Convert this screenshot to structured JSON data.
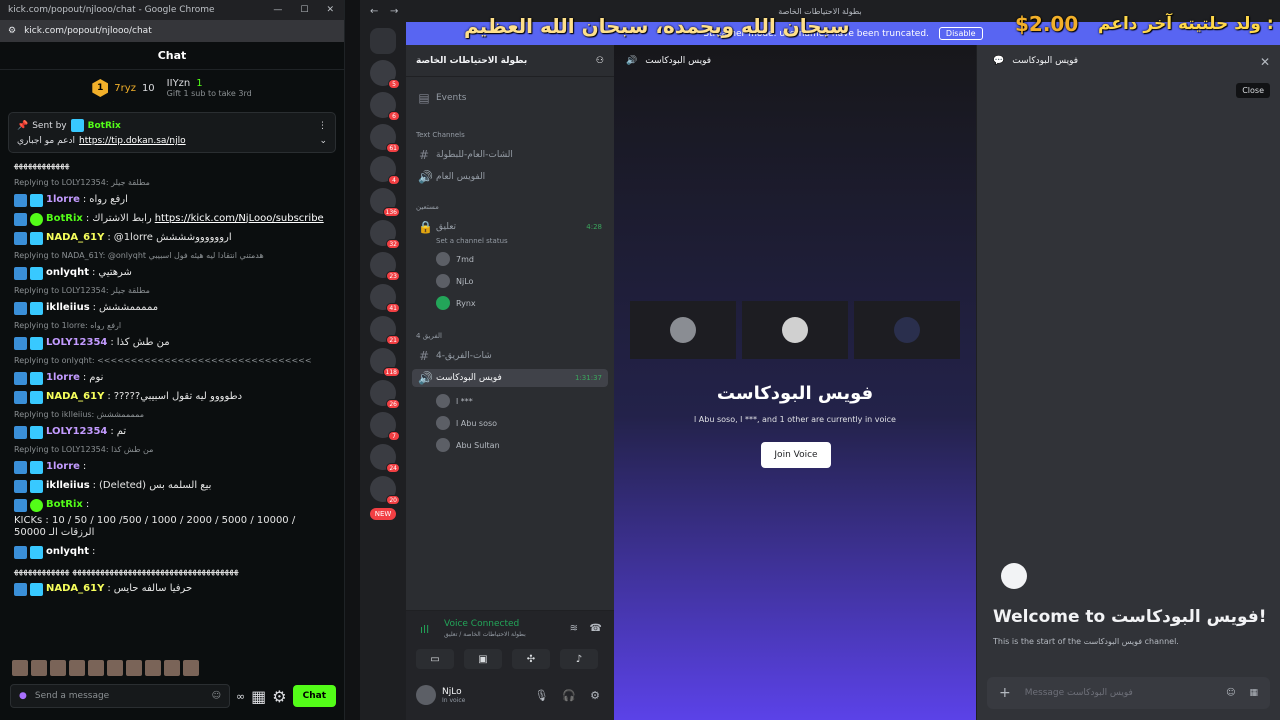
{
  "kick": {
    "browser_title": "kick.com/popout/njlooo/chat - Google Chrome",
    "url": "kick.com/popout/njlooo/chat",
    "chat_title": "Chat",
    "leaderboard": [
      {
        "rank": "1",
        "name": "7ryz",
        "count": "10"
      },
      {
        "name": "IIYzn",
        "count": "1"
      }
    ],
    "leaderboard_gift_note": "Gift 1 sub to take 3rd",
    "pinned": {
      "sent_by": "Sent by",
      "bot": "BotRix",
      "text": "ادعم مو اجباري",
      "link": "https://tip.dokan.sa/njlo"
    },
    "messages": [
      {
        "kind": "plain",
        "text": "ﻬﻬﻬﻬﻬﻬﻬﻬﻬﻬﻬﻬ"
      },
      {
        "kind": "reply",
        "text": "Replying to LOLY12354: مطلقة جيلر"
      },
      {
        "kind": "msg",
        "user": "1lorre",
        "color": "#c39bff",
        "text": "ارفع رواه"
      },
      {
        "kind": "msg",
        "user": "BotRix",
        "color": "#53fc18",
        "text": "رابط الاشتراك",
        "link": "https://kick.com/NjLooo/subscribe"
      },
      {
        "kind": "msg",
        "user": "NADA_61Y",
        "color": "#f7ff5c",
        "text": "@1lorre ارووووووشششش"
      },
      {
        "kind": "reply",
        "text": "Replying to NADA_61Y: @onlyqht هدمتني انتقادا ليه هيئه فول اسبيبي"
      },
      {
        "kind": "msg",
        "user": "onlyqht",
        "color": "#ffffff",
        "text": "شرهتيي"
      },
      {
        "kind": "reply",
        "text": "Replying to LOLY12354: مطلقة جيلر"
      },
      {
        "kind": "msg",
        "user": "iklleiius",
        "color": "#ffffff",
        "text": "مممممششش"
      },
      {
        "kind": "reply",
        "text": "Replying to 1lorre: ارفع رواه"
      },
      {
        "kind": "msg",
        "user": "LOLY12354",
        "color": "#c39bff",
        "text": "من طش كذا"
      },
      {
        "kind": "reply",
        "text": "Replying to onlyqht: <<<<<<<<<<<<<<<<<<<<<<<<<<<<<<<<"
      },
      {
        "kind": "msg",
        "user": "1lorre",
        "color": "#c39bff",
        "text": "نوم"
      },
      {
        "kind": "msg",
        "user": "NADA_61Y",
        "color": "#f7ff5c",
        "text": "?????دطوووو ليه تقول اسبيبي"
      },
      {
        "kind": "reply",
        "text": "Replying to iklleiius: مممممششش"
      },
      {
        "kind": "msg",
        "user": "LOLY12354",
        "color": "#c39bff",
        "text": "تم"
      },
      {
        "kind": "reply",
        "text": "Replying to LOLY12354: من طش كذا"
      },
      {
        "kind": "msg",
        "user": "1lorre",
        "color": "#c39bff",
        "text": ""
      },
      {
        "kind": "msg",
        "user": "iklleiius",
        "color": "#ffffff",
        "text": "(Deleted) بيع السلمه بس"
      },
      {
        "kind": "msg",
        "user": "BotRix",
        "color": "#53fc18",
        "text": "KICKs : 10 / 50 / 100 /500 / 1000 / 2000 / 5000 / 10000 / 50000 الرزقات الـ"
      },
      {
        "kind": "msg",
        "user": "onlyqht",
        "color": "#ffffff",
        "text": ""
      },
      {
        "kind": "plain",
        "text": "ﻬﻬﻬﻬﻬﻬﻬﻬﻬﻬﻬﻬﻬﻬﻬﻬﻬﻬﻬﻬﻬﻬﻬﻬﻬﻬﻬﻬﻬﻬﻬﻬﻬﻬﻬﻬ ﻬﻬﻬﻬﻬﻬﻬﻬﻬﻬﻬﻬ"
      },
      {
        "kind": "msg",
        "user": "NADA_61Y",
        "color": "#f7ff5c",
        "text": "حرفيا سالفه حايس"
      }
    ],
    "input_placeholder": "Send a message",
    "infinity": "∞",
    "chat_button": "Chat"
  },
  "discord": {
    "window_title": "بطولة الاحتياطات الخاصة",
    "overlay_text": "سبحان الله وبحمده، سبحان الله العظيم",
    "overlay_amount": "$2.00",
    "overlay_label": "ولد حلتيته آخر داعم :",
    "banner_text": "Streamer mode. usernames have been truncated.",
    "banner_button": "Disable",
    "server_name": "بطولة الاحتياطات الخاصة",
    "events": "Events",
    "text_channels": "Text Channels",
    "channels": {
      "general_chat": "الشات-العام-للبطولة",
      "general_voice": "الفويس العام",
      "cat_waiting": "مستعين",
      "waiting_voice": "تعليق",
      "waiting_time": "4:28",
      "channel_status": "Set a channel status",
      "waiting_users": [
        "7md",
        "NjLo",
        "Rynx"
      ],
      "cat_team4": "الفريق 4",
      "team_chat": "شات-الفريق-4",
      "podcast": "فويس البودكاست",
      "podcast_time": "1:31:37",
      "podcast_users": [
        "l ***",
        "l Abu soso",
        "Abu Sultan"
      ]
    },
    "servers": [
      "5",
      "6",
      "61",
      "4",
      "136",
      "32",
      "23",
      "41",
      "21",
      "118",
      "26",
      "7",
      "24",
      "20"
    ],
    "new_badge": "NEW",
    "voice_connected": "Voice Connected",
    "voice_sub": "بطولة الاحتياطات الخاصة / تعليق",
    "self_name": "NjLo",
    "self_status": "In voice",
    "stage_channel": "فويس البودكاست",
    "stage_title": "فويس البودكاست",
    "stage_sub": "l Abu soso, l ***, and 1 other are currently in voice",
    "join_voice": "Join Voice",
    "tchat_channel": "فويس البودكاست",
    "close_tooltip": "Close",
    "welcome": "Welcome to فويس البودكاست!",
    "welcome_sub": "This is the start of the فويس البودكاست channel.",
    "msg_placeholder": "Message فويس البودكاست"
  },
  "colors": {
    "kick_green": "#53fc18",
    "discord_blurple": "#5865f2",
    "voice_green": "#23a559"
  }
}
